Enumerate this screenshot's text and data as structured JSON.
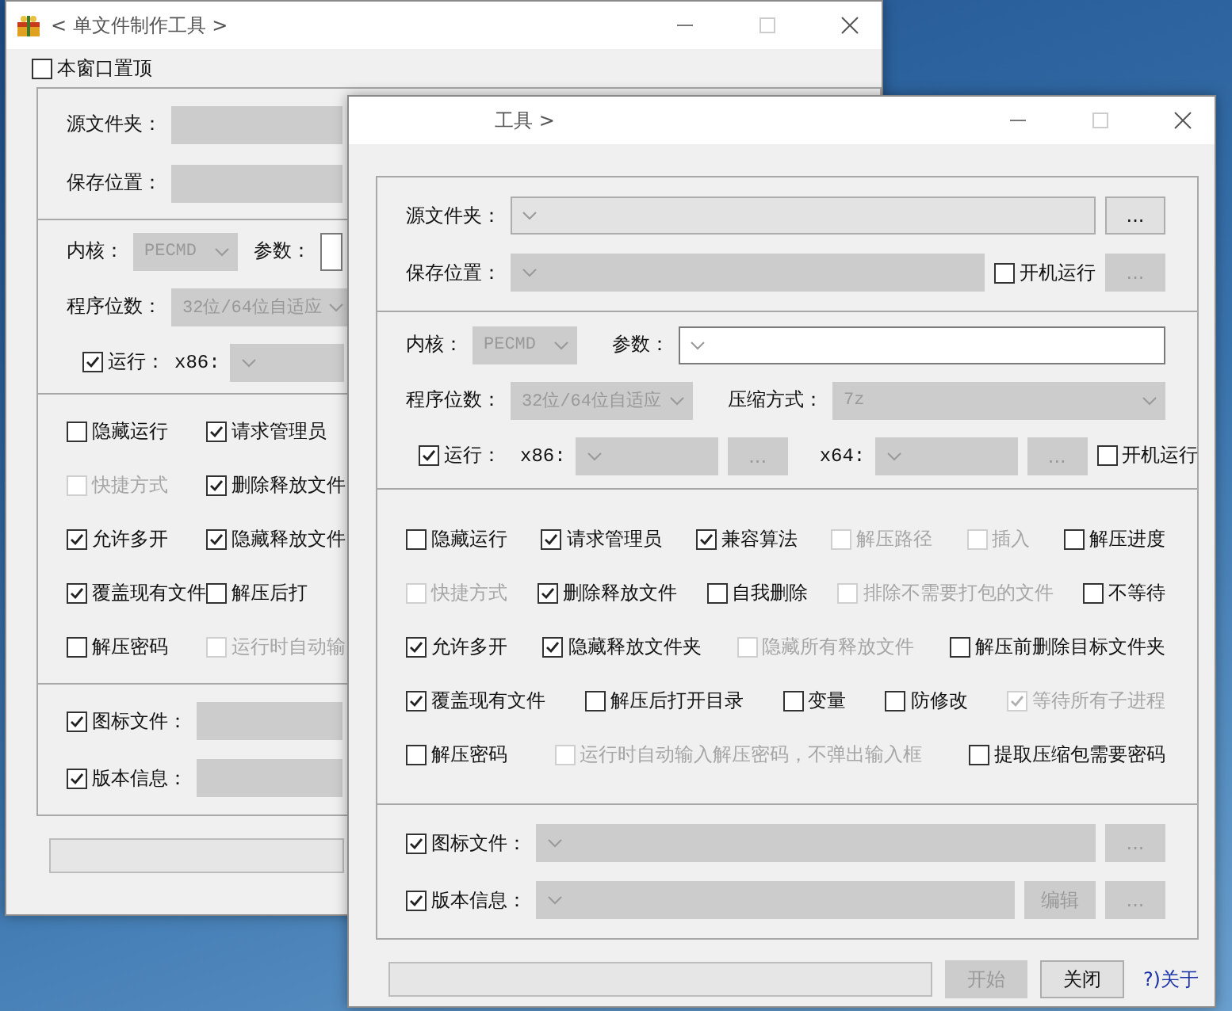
{
  "back_window": {
    "title": "< 单文件制作工具 >",
    "topmost": {
      "label": "本窗口置顶",
      "checked": false
    },
    "source": {
      "label": "源文件夹："
    },
    "save": {
      "label": "保存位置："
    },
    "kernel": {
      "label": "内核：",
      "value": "PECMD"
    },
    "params": {
      "label": "参数："
    },
    "bits": {
      "label": "程序位数：",
      "value": "32位/64位自适应"
    },
    "run": {
      "label": "运行：",
      "checked": true
    },
    "x86": {
      "label": "x86:"
    },
    "options": [
      [
        {
          "label": "隐藏运行",
          "checked": false,
          "disabled": false
        },
        {
          "label": "请求管理员",
          "checked": true,
          "disabled": false
        }
      ],
      [
        {
          "label": "快捷方式",
          "checked": false,
          "disabled": true
        },
        {
          "label": "删除释放文件",
          "checked": true,
          "disabled": false
        }
      ],
      [
        {
          "label": "允许多开",
          "checked": true,
          "disabled": false
        },
        {
          "label": "隐藏释放文件",
          "checked": true,
          "disabled": false
        }
      ],
      [
        {
          "label": "覆盖现有文件",
          "checked": true,
          "disabled": false
        },
        {
          "label": "解压后打",
          "checked": false,
          "disabled": false
        }
      ],
      [
        {
          "label": "解压密码",
          "checked": false,
          "disabled": false
        },
        {
          "label": "运行时自动输",
          "checked": false,
          "disabled": true
        }
      ]
    ],
    "icon_file": {
      "label": "图标文件：",
      "checked": true
    },
    "version_info": {
      "label": "版本信息：",
      "checked": true
    },
    "progress": {
      "level": 0
    }
  },
  "front_window": {
    "title": "工具 >",
    "source": {
      "label": "源文件夹：",
      "disabled": false,
      "browse": {
        "label": "...",
        "disabled": false
      }
    },
    "save": {
      "label": "保存位置：",
      "disabled": true,
      "autostart": {
        "label": "开机运行",
        "checked": false
      },
      "browse": {
        "label": "...",
        "disabled": true
      }
    },
    "kernel": {
      "label": "内核：",
      "value": "PECMD"
    },
    "params": {
      "label": "参数："
    },
    "bits": {
      "label": "程序位数：",
      "value": "32位/64位自适应"
    },
    "compression": {
      "label": "压缩方式：",
      "value": "7z"
    },
    "run": {
      "label": "运行：",
      "checked": true
    },
    "x86": {
      "label": "x86:",
      "browse": {
        "label": "...",
        "disabled": true
      }
    },
    "x64": {
      "label": "x64:",
      "browse": {
        "label": "...",
        "disabled": true
      }
    },
    "run_autostart": {
      "label": "开机运行",
      "checked": false
    },
    "options": [
      [
        {
          "label": "隐藏运行",
          "checked": false,
          "disabled": false
        },
        {
          "label": "请求管理员",
          "checked": true,
          "disabled": false
        },
        {
          "label": "兼容算法",
          "checked": true,
          "disabled": false
        },
        {
          "label": "解压路径",
          "checked": false,
          "disabled": true
        },
        {
          "label": "插入",
          "checked": false,
          "disabled": true
        },
        {
          "label": "解压进度",
          "checked": false,
          "disabled": false
        }
      ],
      [
        {
          "label": "快捷方式",
          "checked": false,
          "disabled": true
        },
        {
          "label": "删除释放文件",
          "checked": true,
          "disabled": false
        },
        {
          "label": "自我删除",
          "checked": false,
          "disabled": false
        },
        {
          "label": "排除不需要打包的文件",
          "checked": false,
          "disabled": true
        },
        {
          "label": "不等待",
          "checked": false,
          "disabled": false
        }
      ],
      [
        {
          "label": "允许多开",
          "checked": true,
          "disabled": false
        },
        {
          "label": "隐藏释放文件夹",
          "checked": true,
          "disabled": false
        },
        {
          "label": "隐藏所有释放文件",
          "checked": false,
          "disabled": true
        },
        {
          "label": "解压前删除目标文件夹",
          "checked": false,
          "disabled": false
        }
      ],
      [
        {
          "label": "覆盖现有文件",
          "checked": true,
          "disabled": false
        },
        {
          "label": "解压后打开目录",
          "checked": false,
          "disabled": false
        },
        {
          "label": "变量",
          "checked": false,
          "disabled": false
        },
        {
          "label": "防修改",
          "checked": false,
          "disabled": false
        },
        {
          "label": "等待所有子进程",
          "checked": true,
          "disabled": true
        }
      ],
      [
        {
          "label": "解压密码",
          "checked": false,
          "disabled": false
        },
        {
          "label": "运行时自动输入解压密码，不弹出输入框",
          "checked": false,
          "disabled": true
        },
        {
          "label": "提取压缩包需要密码",
          "checked": false,
          "disabled": false
        }
      ]
    ],
    "icon_file": {
      "label": "图标文件：",
      "checked": true,
      "browse": {
        "label": "...",
        "disabled": true
      }
    },
    "version_info": {
      "label": "版本信息：",
      "checked": true,
      "edit": {
        "label": "编辑",
        "disabled": true
      },
      "browse": {
        "label": "...",
        "disabled": true
      }
    },
    "progress": {
      "level": 0
    },
    "start_button": {
      "label": "开始",
      "disabled": true
    },
    "close_button": {
      "label": "关闭",
      "disabled": false
    },
    "about_link": "?)关于"
  }
}
